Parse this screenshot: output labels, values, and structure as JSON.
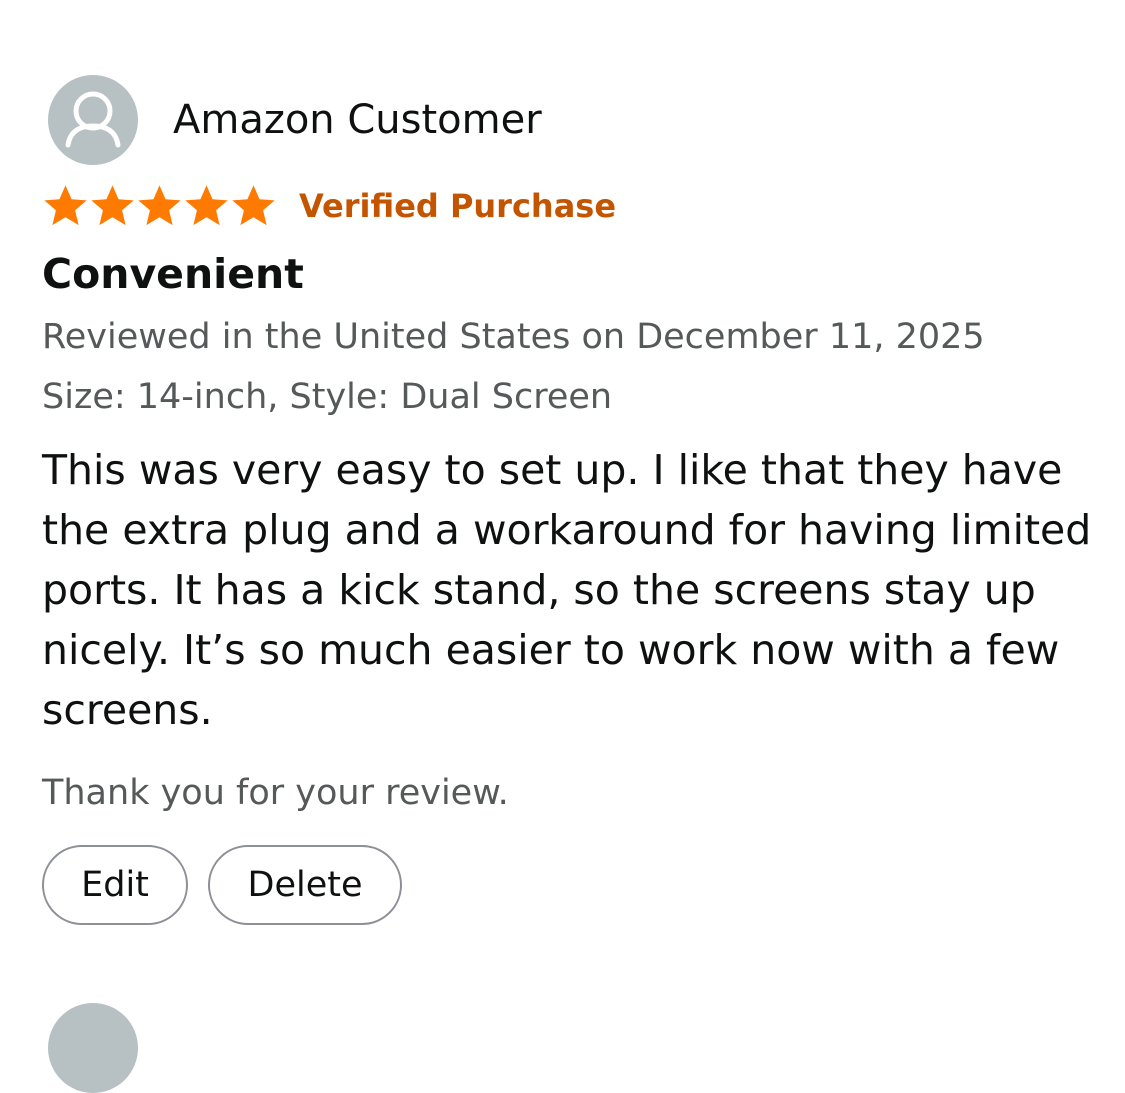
{
  "review": {
    "reviewer_name": "Amazon Customer",
    "avatar_icon": "person-silhouette-icon",
    "rating": 5,
    "rating_max": 5,
    "star_color": "#ff7a00",
    "verified_label": "Verified Purchase",
    "verified_color": "#c45500",
    "title": "Convenient",
    "date_line": "Reviewed in the United States on December 11, 2025",
    "variant_line": "Size: 14-inch, Style: Dual Screen",
    "body": "This was very easy to set up. I like that they have the extra plug and a workaround for having limited ports. It has a kick stand, so the screens stay up nicely. It’s so much easier to work now with a few screens.",
    "thank_you": "Thank you for your review."
  },
  "actions": {
    "edit_label": "Edit",
    "delete_label": "Delete"
  }
}
